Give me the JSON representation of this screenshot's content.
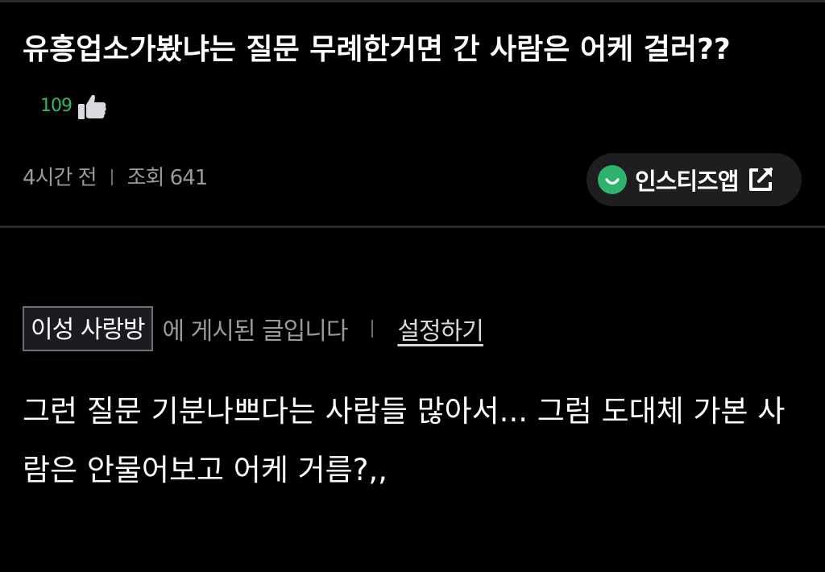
{
  "post": {
    "title": "유흥업소가봤냐는 질문 무례한거면 간 사람은 어케 걸러??",
    "like_count": "109",
    "time_ago": "4시간 전",
    "views": "조회 641",
    "app_button_label": "인스티즈앱",
    "board_name": "이성 사랑방",
    "board_suffix": "에 게시된 글입니다",
    "settings_label": "설정하기",
    "body": "그런 질문 기분나쁘다는 사람들 많아서... 그럼 도대체 가본 사람은 안물어보고 어케 거름?,,"
  },
  "icons": {
    "like": "thumbs-up-icon",
    "app_logo": "smile-logo-icon",
    "external": "external-link-icon"
  },
  "colors": {
    "background": "#000000",
    "like_count": "#2fb86a",
    "app_logo": "#2db36b",
    "meta_text": "#9a9a9e"
  }
}
